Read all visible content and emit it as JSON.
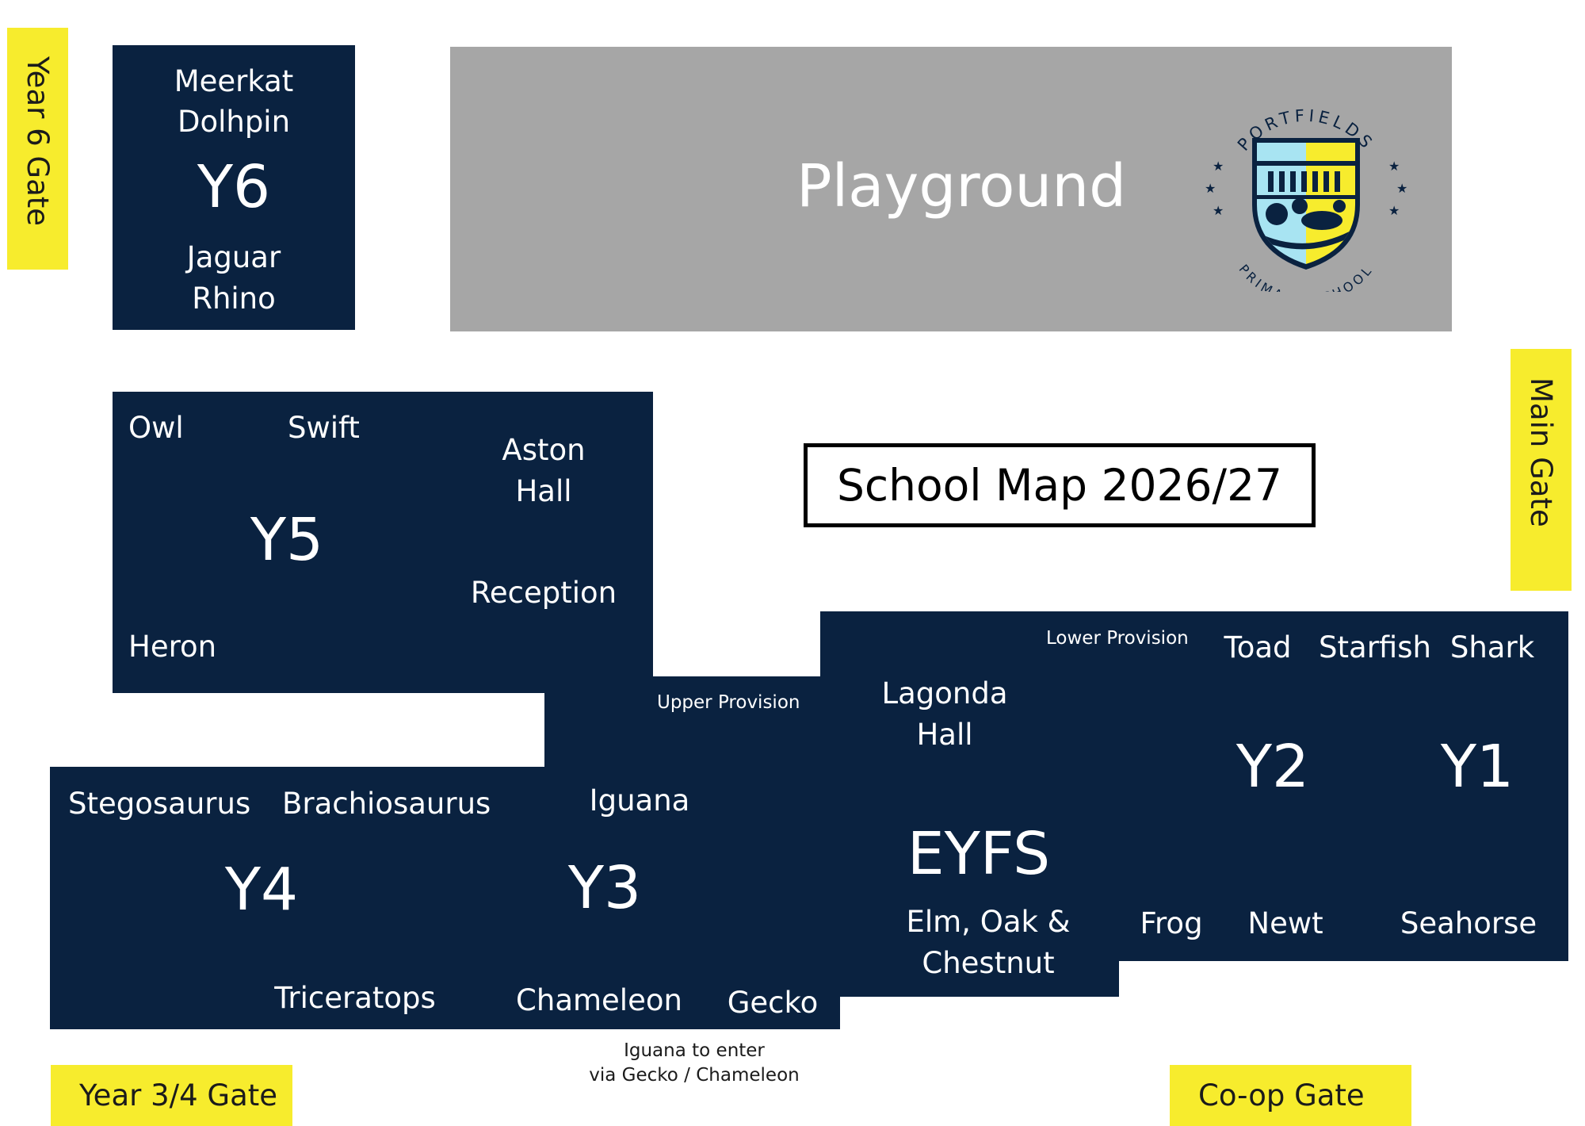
{
  "title": "School Map 2026/27",
  "playground": "Playground",
  "logo": {
    "name_top": "PORTFIELDS",
    "name_bottom": "PRIMARY SCHOOL",
    "colors": {
      "navy": "#0a2240",
      "light_blue": "#a8e4f2",
      "yellow": "#f7ec2d"
    }
  },
  "gates": {
    "year6": "Year 6 Gate",
    "main": "Main Gate",
    "year34": "Year 3/4 Gate",
    "coop": "Co-op Gate"
  },
  "y6": {
    "year": "Y6",
    "rooms": [
      "Meerkat",
      "Dolhpin",
      "Jaguar",
      "Rhino"
    ]
  },
  "y5": {
    "year": "Y5",
    "rooms": {
      "owl": "Owl",
      "swift": "Swift",
      "heron": "Heron"
    },
    "aston_hall": [
      "Aston",
      "Hall"
    ],
    "reception": "Reception"
  },
  "y4": {
    "year": "Y4",
    "rooms": [
      "Stegosaurus",
      "Brachiosaurus",
      "Triceratops"
    ]
  },
  "y3": {
    "year": "Y3",
    "rooms": [
      "Iguana",
      "Chameleon",
      "Gecko"
    ]
  },
  "upper_provision": "Upper Provision",
  "lower_provision": "Lower Provision",
  "eyfs": {
    "year": "EYFS",
    "lagonda_hall": [
      "Lagonda",
      "Hall"
    ],
    "rooms": [
      "Elm, Oak &",
      "Chestnut"
    ]
  },
  "y2": {
    "year": "Y2",
    "rooms": [
      "Toad",
      "Starfish",
      "Frog",
      "Newt"
    ]
  },
  "y1": {
    "year": "Y1",
    "rooms": [
      "Shark",
      "Seahorse"
    ]
  },
  "iguana_note": [
    "Iguana to enter",
    "via Gecko / Chameleon"
  ],
  "colors": {
    "building": "#0a2240",
    "playground": "#a6a6a6",
    "gate": "#f7ec2d"
  }
}
